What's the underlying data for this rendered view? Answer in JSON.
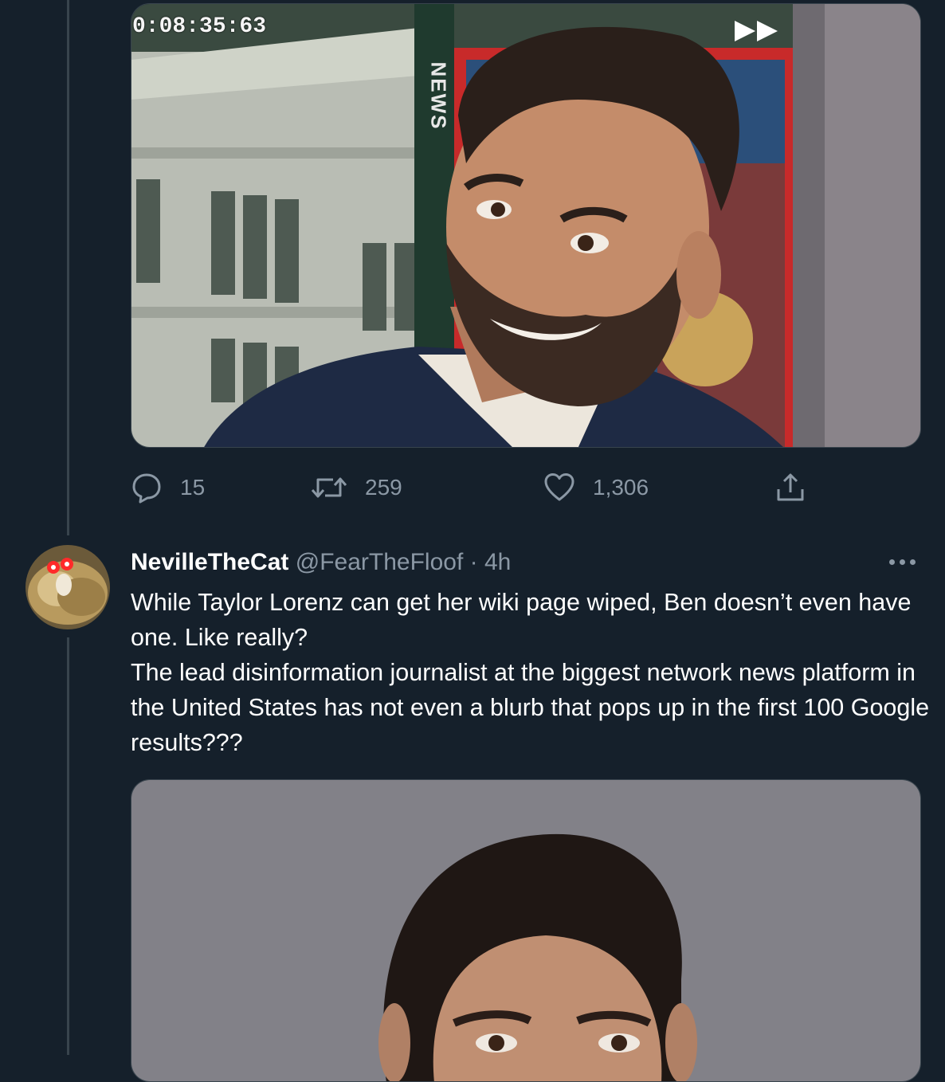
{
  "first_tweet": {
    "media": {
      "timecode": "0:08:35:63",
      "channel_label": "NEWS",
      "alt": "photo"
    },
    "actions": {
      "replies": "15",
      "retweets": "259",
      "likes": "1,306"
    }
  },
  "second_tweet": {
    "display_name": "NevilleTheCat",
    "handle": "@FearTheFloof",
    "separator": "·",
    "time": "4h",
    "text_lines": [
      "While Taylor Lorenz can get her wiki page wiped, Ben doesn’t even have one. Like really?",
      "The lead disinformation journalist at the biggest network news platform in the United States has not even a blurb that pops up in the first 100 Google results???"
    ]
  },
  "colors": {
    "background": "#15202b",
    "border": "#38444d",
    "secondary_text": "#8b98a5",
    "primary_text": "#ffffff"
  },
  "icons": [
    "reply-icon",
    "retweet-icon",
    "like-icon",
    "share-icon",
    "more-icon",
    "fast-forward-icon"
  ]
}
